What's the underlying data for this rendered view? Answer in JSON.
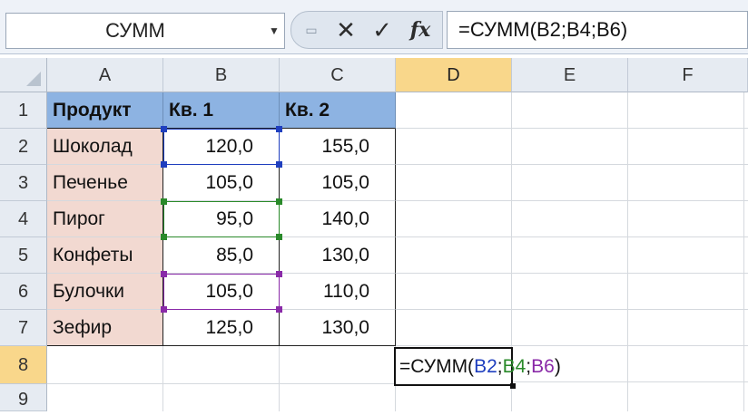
{
  "name_box": {
    "value": "СУММ"
  },
  "formula_bar": {
    "formula": "=СУММ(B2;B4;B6)"
  },
  "columns": [
    "A",
    "B",
    "C",
    "D",
    "E",
    "F"
  ],
  "rows": [
    "1",
    "2",
    "3",
    "4",
    "5",
    "6",
    "7",
    "8",
    "9"
  ],
  "table": {
    "headers": [
      "Продукт",
      "Кв. 1",
      "Кв. 2"
    ],
    "data": [
      [
        "Шоколад",
        "120,0",
        "155,0"
      ],
      [
        "Печенье",
        "105,0",
        "105,0"
      ],
      [
        "Пирог",
        "95,0",
        "140,0"
      ],
      [
        "Конфеты",
        "85,0",
        "130,0"
      ],
      [
        "Булочки",
        "105,0",
        "110,0"
      ],
      [
        "Зефир",
        "125,0",
        "130,0"
      ]
    ]
  },
  "active_cell": {
    "parts": [
      "=СУММ(",
      "B2",
      ";",
      "B4",
      ";",
      "B6",
      ")"
    ]
  },
  "colors": {
    "ref_b2": "#1f3fbf",
    "ref_b4": "#2a8a2a",
    "ref_b6": "#8a2aa8",
    "header_fill": "#8db3e2",
    "product_fill": "#f2d9d1",
    "selected_header": "#f9d78b"
  },
  "icons": [
    "grip-icon",
    "cancel-icon",
    "enter-icon",
    "insert-function-icon",
    "dropdown-arrow-icon"
  ]
}
